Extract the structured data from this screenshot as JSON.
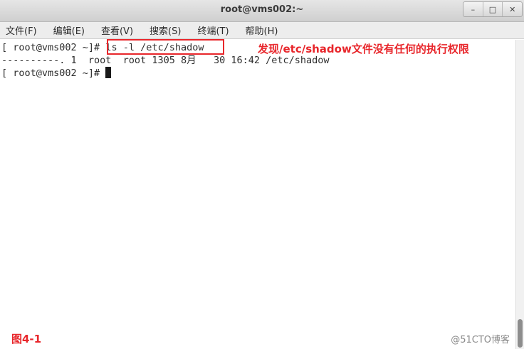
{
  "window": {
    "title": "root@vms002:~",
    "controls": {
      "minimize": "–",
      "maximize": "□",
      "close": "✕"
    }
  },
  "menubar": {
    "items": [
      {
        "label": "文件(F)"
      },
      {
        "label": "编辑(E)"
      },
      {
        "label": "查看(V)"
      },
      {
        "label": "搜索(S)"
      },
      {
        "label": "终端(T)"
      },
      {
        "label": "帮助(H)"
      }
    ]
  },
  "terminal": {
    "prompt1": "[ root@vms002 ~]# ",
    "command1": "ls -l /etc/shadow",
    "output1": "----------. 1  root  root 1305 8月   30 16:42 /etc/shadow",
    "prompt2": "[ root@vms002 ~]# "
  },
  "annotation": {
    "text": "发现/etc/shadow文件没有任何的执行权限",
    "color": "#e8262b"
  },
  "figure_label": "图4-1",
  "watermark": "@51CTO博客"
}
